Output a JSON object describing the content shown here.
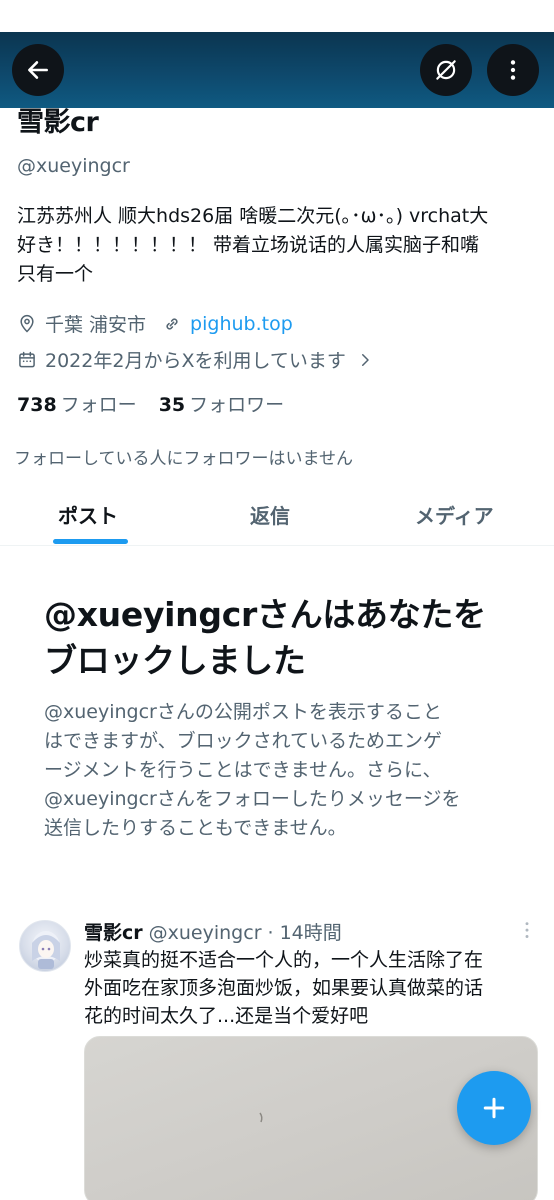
{
  "header": {
    "back_icon": "arrow-left-icon",
    "hide_icon": "eye-slash-icon",
    "more_icon": "more-vertical-icon",
    "background": "#0e4a6e"
  },
  "profile": {
    "name": "雪影cr",
    "handle": "@xueyingcr",
    "bio_line1": "江苏苏州人 顺大hds26届 啥暖二次元(｡･ω･｡) vrchat大",
    "bio_line2": "好き！！！！！！！！ 带着立场说话的人属实脑子和嘴",
    "bio_line3": "只有一个",
    "location": "千葉 浦安市",
    "website": "pighub.top",
    "joined": "2022年2月からXを利用しています",
    "following_count": "738",
    "following_label": "フォロー",
    "followers_count": "35",
    "followers_label": "フォロワー",
    "follow_note": "フォローしている人にフォロワーはいません"
  },
  "tabs": [
    {
      "label": "ポスト",
      "active": true
    },
    {
      "label": "返信",
      "active": false
    },
    {
      "label": "メディア",
      "active": false
    }
  ],
  "blocked": {
    "title_line1": "@xueyingcrさんはあなたを",
    "title_line2": "ブロックしました",
    "desc_line1": "@xueyingcrさんの公開ポストを表示すること",
    "desc_line2": "はできますが、ブロックされているためエンゲ",
    "desc_line3": "ージメントを行うことはできません。さらに、",
    "desc_line4": "@xueyingcrさんをフォローしたりメッセージを",
    "desc_line5": "送信したりすることもできません。"
  },
  "post": {
    "name": "雪影cr",
    "handle": "@xueyingcr",
    "time": "· 14時間",
    "text_line1": "炒菜真的挺不适合一个人的，一个人生活除了在",
    "text_line2": "外面吃在家顶多泡面炒饭，如果要认真做菜的话",
    "text_line3": "花的时间太久了...还是当个爱好吧"
  },
  "fab": {
    "icon": "plus-icon",
    "color": "#1d9bf0"
  },
  "colors": {
    "accent": "#1d9bf0",
    "secondary_text": "#536471",
    "primary_text": "#0f1419"
  }
}
